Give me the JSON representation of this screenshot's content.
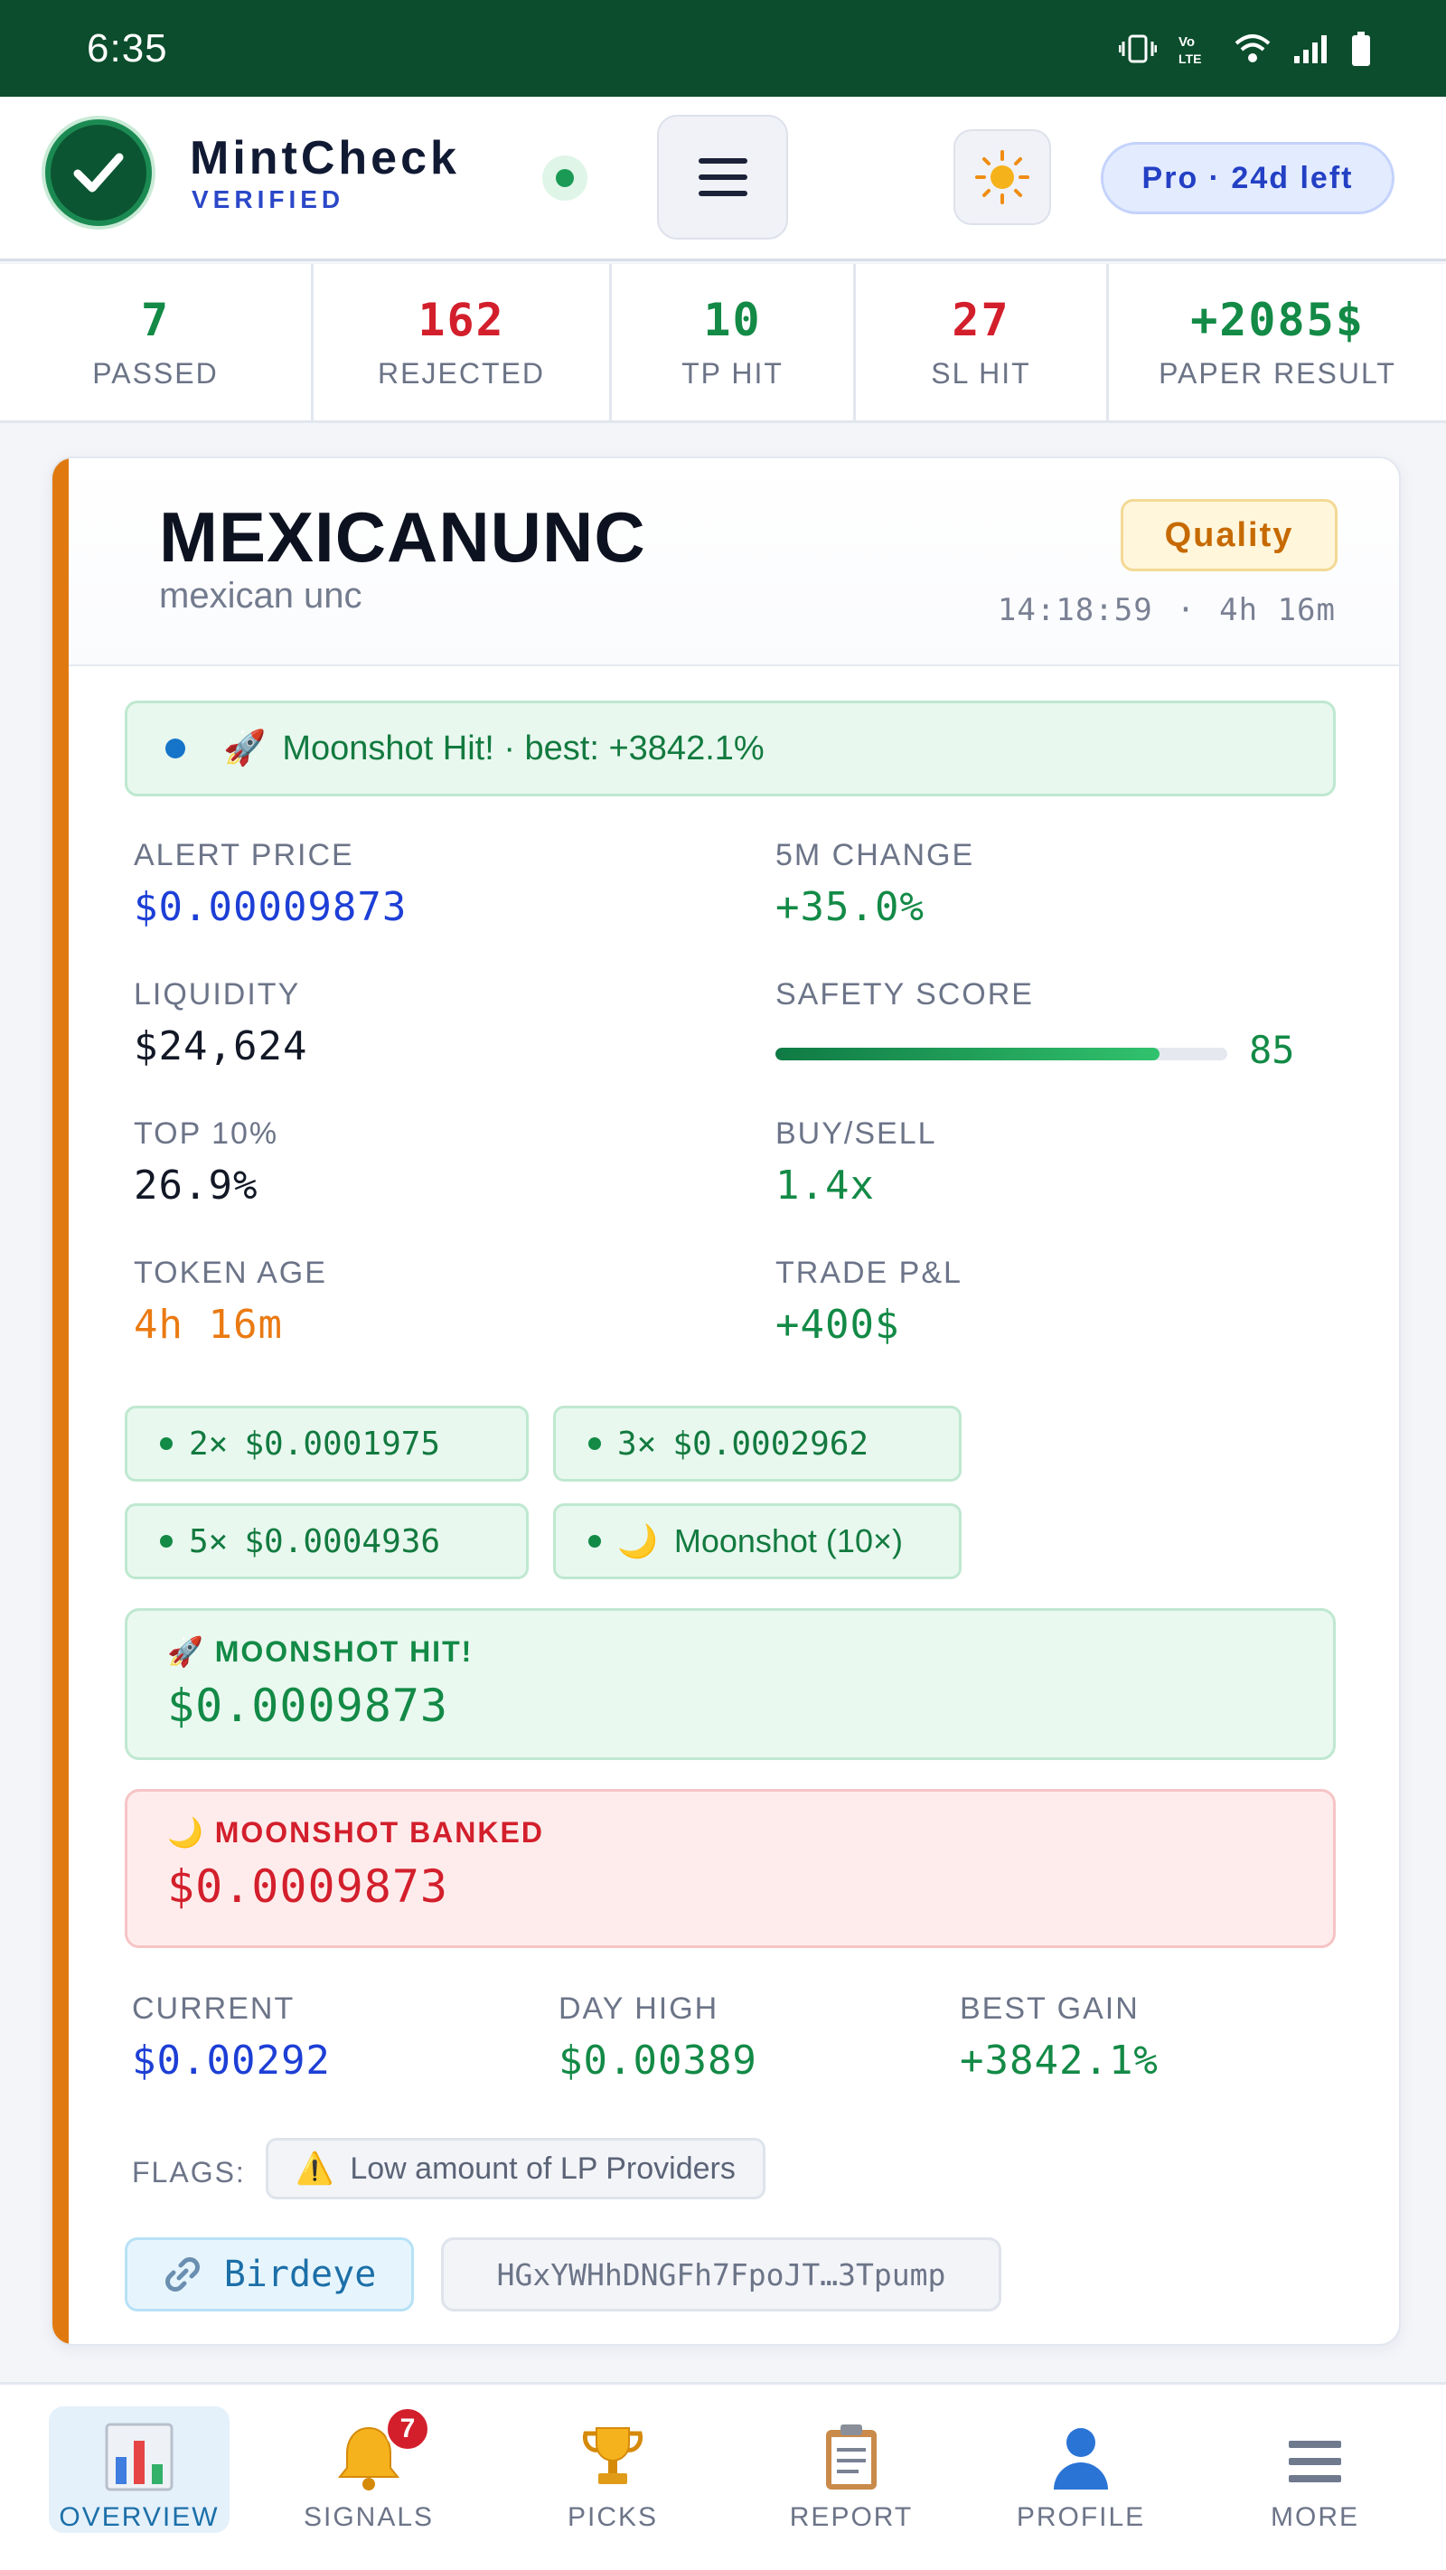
{
  "status_bar": {
    "time": "6:35"
  },
  "header": {
    "brand": "MintCheck",
    "brand_sub": "VERIFIED",
    "plan": "Pro · 24d left"
  },
  "stats": [
    {
      "value": "7",
      "label": "PASSED",
      "color": "#138a46"
    },
    {
      "value": "162",
      "label": "REJECTED",
      "color": "#d31f2c"
    },
    {
      "value": "10",
      "label": "TP HIT",
      "color": "#138a46"
    },
    {
      "value": "27",
      "label": "SL HIT",
      "color": "#d31f2c"
    },
    {
      "value": "+2085$",
      "label": "PAPER RESULT",
      "color": "#138a46"
    }
  ],
  "card": {
    "symbol": "MEXICANUNC",
    "name": "mexican unc",
    "badge": "Quality",
    "time": "14:18:59",
    "time_sep": "·",
    "age": "4h 16m",
    "status_emoji": "🚀",
    "status_text": "Moonshot Hit! · best: +3842.1%",
    "metrics": {
      "alert_price": {
        "label": "ALERT PRICE",
        "value": "$0.00009873"
      },
      "change_5m": {
        "label": "5M CHANGE",
        "value": "+35.0%"
      },
      "liquidity": {
        "label": "LIQUIDITY",
        "value": "$24,624"
      },
      "safety_score": {
        "label": "SAFETY SCORE",
        "value": "85",
        "fraction": 0.85
      },
      "top10": {
        "label": "TOP 10%",
        "value": "26.9%"
      },
      "buy_sell": {
        "label": "BUY/SELL",
        "value": "1.4x"
      },
      "token_age": {
        "label": "TOKEN AGE",
        "value": "4h 16m"
      },
      "trade_pnl": {
        "label": "TRADE P&L",
        "value": "+400$"
      }
    },
    "targets": [
      {
        "mult": "2×",
        "price": "$0.0001975"
      },
      {
        "mult": "3×",
        "price": "$0.0002962"
      },
      {
        "mult": "5×",
        "price": "$0.0004936"
      },
      {
        "mult": "🌙",
        "price": "Moonshot (10×)"
      }
    ],
    "hit_callout": {
      "emoji": "🚀",
      "title": "MOONSHOT HIT!",
      "value": "$0.0009873"
    },
    "banked_callout": {
      "emoji": "🌙",
      "title": "MOONSHOT BANKED",
      "value": "$0.0009873"
    },
    "current": {
      "label": "CURRENT",
      "value": "$0.00292"
    },
    "day_high": {
      "label": "DAY HIGH",
      "value": "$0.00389"
    },
    "best_gain": {
      "label": "BEST GAIN",
      "value": "+3842.1%"
    },
    "flags_label": "FLAGS:",
    "flag": {
      "icon": "⚠️",
      "text": "Low amount of LP Providers"
    },
    "birdeye": "Birdeye",
    "address": "HGxYWHhDNGFh7FpoJT…3Tpump"
  },
  "nav": {
    "items": [
      {
        "label": "OVERVIEW",
        "icon": "chart-icon"
      },
      {
        "label": "SIGNALS",
        "icon": "bell-icon",
        "badge": "7"
      },
      {
        "label": "PICKS",
        "icon": "trophy-icon"
      },
      {
        "label": "REPORT",
        "icon": "clipboard-icon"
      },
      {
        "label": "PROFILE",
        "icon": "user-icon"
      },
      {
        "label": "MORE",
        "icon": "menu-icon"
      }
    ]
  }
}
